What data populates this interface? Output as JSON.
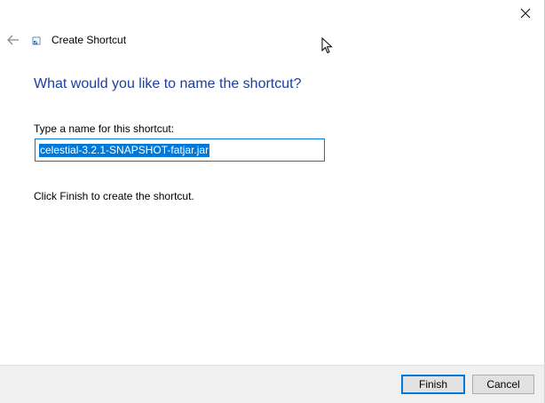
{
  "wizard": {
    "title": "Create Shortcut",
    "heading": "What would you like to name the shortcut?",
    "name_label": "Type a name for this shortcut:",
    "name_value": "celestial-3.2.1-SNAPSHOT-fatjar.jar",
    "instruction": "Click Finish to create the shortcut."
  },
  "buttons": {
    "finish": "Finish",
    "cancel": "Cancel"
  },
  "icons": {
    "close": "close-icon",
    "back": "back-arrow-icon",
    "title": "shortcut-icon",
    "cursor": "mouse-pointer-icon"
  },
  "colors": {
    "heading": "#1c3fa0",
    "selection": "#0078d7",
    "footer": "#f0f0f0"
  }
}
